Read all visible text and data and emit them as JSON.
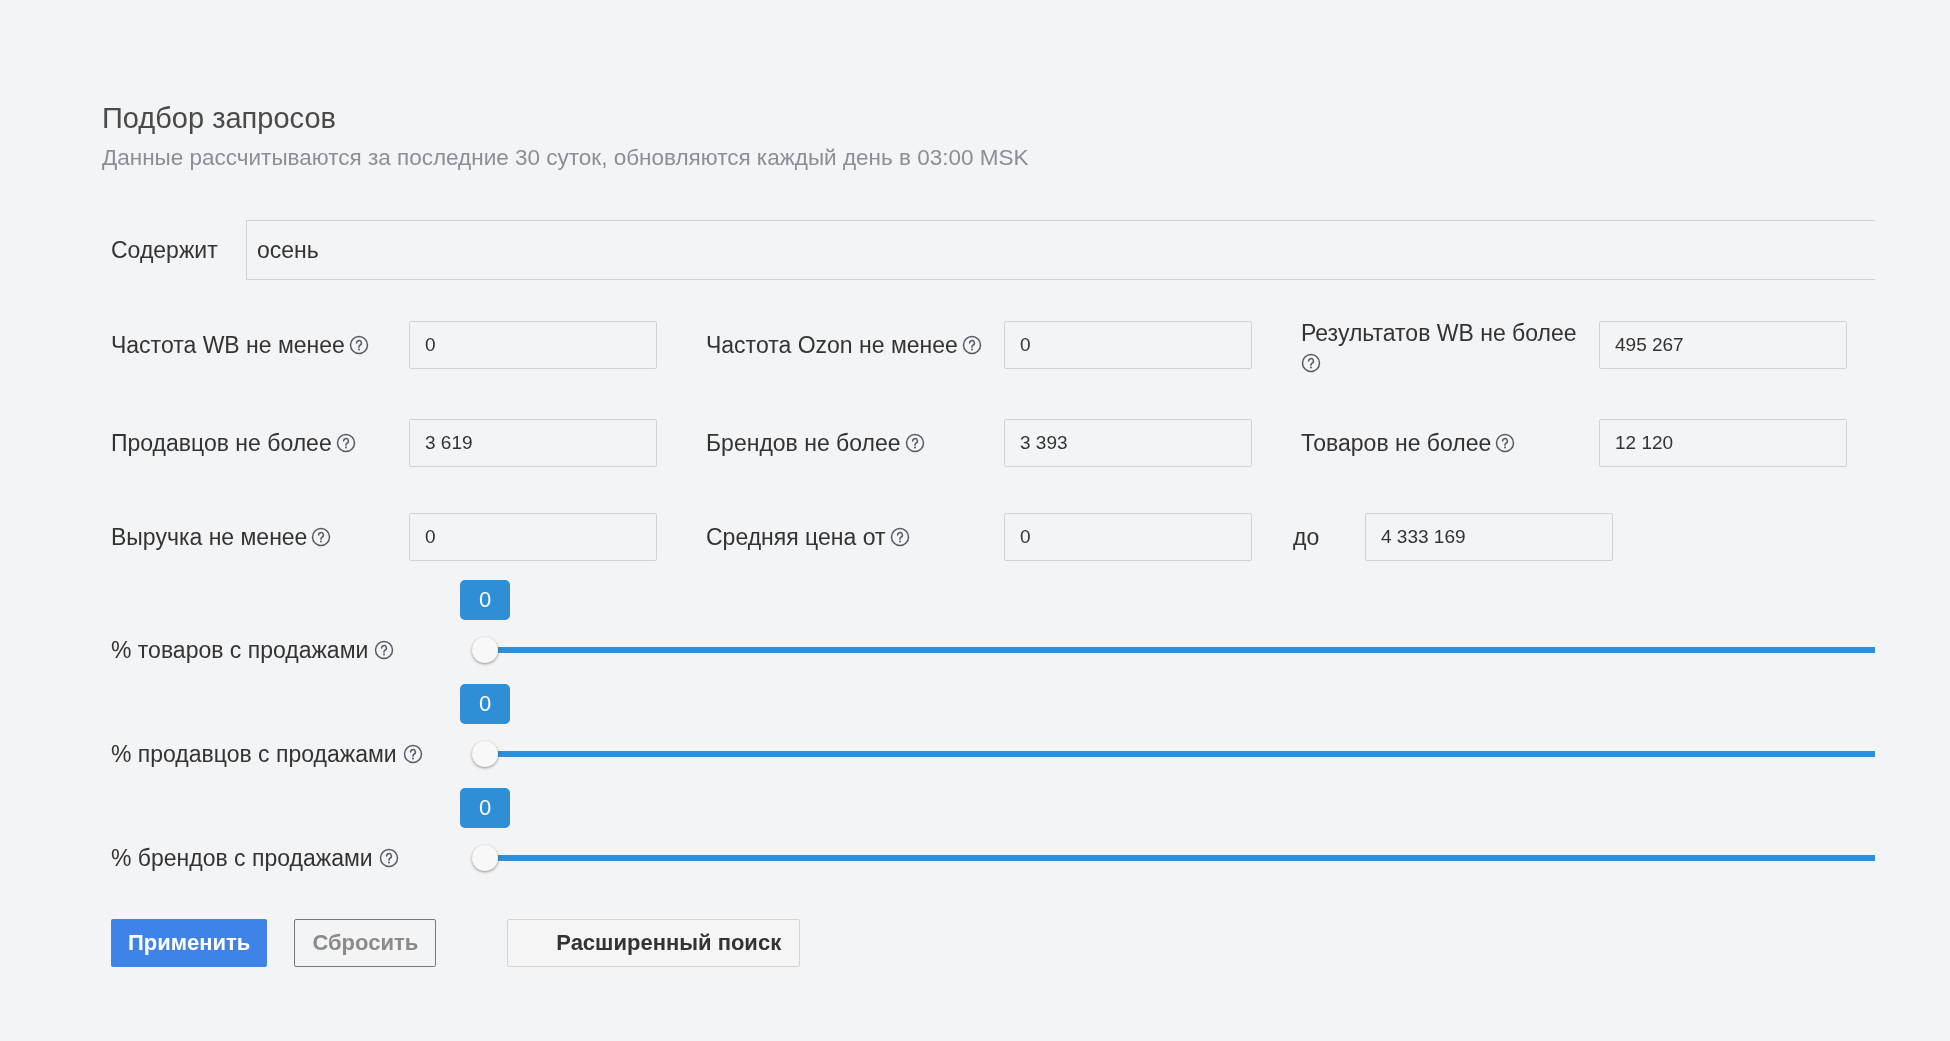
{
  "header": {
    "title": "Подбор запросов",
    "subtitle": "Данные рассчитываются за последние 30 суток, обновляются каждый день в 03:00 MSK"
  },
  "contains": {
    "label": "Содержит",
    "value": "осень"
  },
  "filter_rows": [
    [
      {
        "kind": "field",
        "label": "Частота WB не менее",
        "value": "0"
      },
      {
        "kind": "field",
        "label": "Частота Ozon не менее",
        "value": "0"
      },
      {
        "kind": "field",
        "label": "Результатов WB не более",
        "value": "495 267"
      }
    ],
    [
      {
        "kind": "field",
        "label": "Продавцов не более",
        "value": "3 619"
      },
      {
        "kind": "field",
        "label": "Брендов не более",
        "value": "3 393"
      },
      {
        "kind": "field",
        "label": "Товаров не более",
        "value": "12 120"
      }
    ],
    [
      {
        "kind": "field",
        "label": "Выручка не менее",
        "value": "0"
      },
      {
        "kind": "field",
        "label": "Средняя цена от",
        "value": "0"
      },
      {
        "kind": "range_end",
        "label": "до",
        "value": "4 333 169"
      }
    ]
  ],
  "sliders": [
    {
      "label": "% товаров с продажами",
      "level": 0,
      "reading": "0"
    },
    {
      "label": "% продавцов с продажами",
      "level": 0,
      "reading": "0"
    },
    {
      "label": "% брендов с продажами",
      "level": 0,
      "reading": "0"
    }
  ],
  "buttons": [
    {
      "kind": "primary",
      "label": "Применить"
    },
    {
      "kind": "secondary",
      "label": "Сбросить"
    },
    {
      "kind": "tertiary",
      "label": "Расширенный поиск"
    }
  ]
}
